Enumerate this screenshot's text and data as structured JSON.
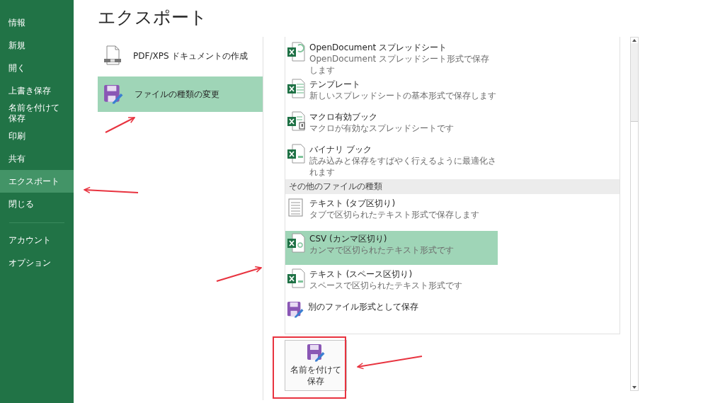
{
  "title": "エクスポート",
  "sidebar": {
    "items": [
      {
        "label": "情報",
        "selected": false
      },
      {
        "label": "新規",
        "selected": false
      },
      {
        "label": "開く",
        "selected": false
      },
      {
        "label": "上書き保存",
        "selected": false
      },
      {
        "label": "名前を付けて保存",
        "selected": false
      },
      {
        "label": "印刷",
        "selected": false
      },
      {
        "label": "共有",
        "selected": false
      },
      {
        "label": "エクスポート",
        "selected": true
      },
      {
        "label": "閉じる",
        "selected": false
      }
    ],
    "bottom_items": [
      {
        "label": "アカウント",
        "selected": false
      },
      {
        "label": "オプション",
        "selected": false
      }
    ]
  },
  "export_options": [
    {
      "kind": "pdf",
      "label": "PDF/XPS ドキュメントの作成",
      "selected": false
    },
    {
      "kind": "save",
      "label": "ファイルの種類の変更",
      "selected": true
    }
  ],
  "file_types": {
    "items": [
      {
        "kind": "ods",
        "title": "OpenDocument スプレッドシート",
        "description": "OpenDocument スプレッドシート形式で保存します",
        "selected": false
      },
      {
        "kind": "template",
        "title": "テンプレート",
        "description": "新しいスプレッドシートの基本形式で保存します",
        "selected": false
      },
      {
        "kind": "macro",
        "title": "マクロ有効ブック",
        "description": "マクロが有効なスプレッドシートです",
        "selected": false
      },
      {
        "kind": "binary",
        "title": "バイナリ ブック",
        "description": "読み込みと保存をすばやく行えるように最適化されます",
        "selected": false
      }
    ],
    "other_header": "その他のファイルの種類",
    "other_items": [
      {
        "kind": "text",
        "title": "テキスト (タブ区切り)",
        "description": "タブで区切られたテキスト形式で保存します",
        "selected": false
      },
      {
        "kind": "csv",
        "title": "CSV (カンマ区切り)",
        "description": "カンマで区切られたテキスト形式です",
        "selected": true
      },
      {
        "kind": "binary",
        "title": "テキスト (スペース区切り)",
        "description": "スペースで区切られたテキスト形式です",
        "selected": false
      },
      {
        "kind": "save",
        "title": "別のファイル形式として保存",
        "selected": false
      }
    ]
  },
  "save_as_button": {
    "label": "名前を付けて保存"
  }
}
